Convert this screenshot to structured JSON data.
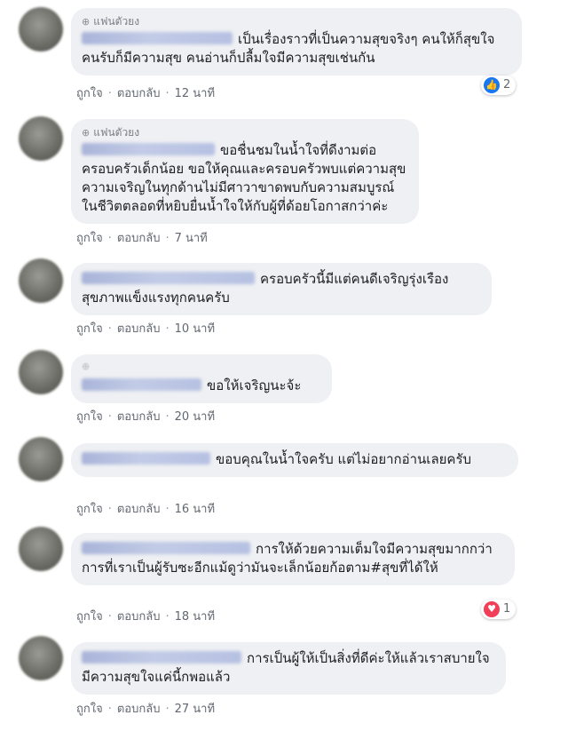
{
  "actions": {
    "like_label": "ถูกใจ",
    "reply_label": "ตอบกลับ",
    "separator": "·"
  },
  "comments": [
    {
      "badge": "แฟนตัวยง",
      "text": "เป็นเรื่องราวที่เป็นความสุขจริงๆ คนให้ก็สุขใจ คนรับก็มีความสุข คนอ่านก็ปลื้มใจมีความสุขเช่นกัน",
      "time": "12 นาที",
      "reaction": {
        "icon": "like-icon",
        "count": "2"
      }
    },
    {
      "badge": "แฟนตัวยง",
      "text": "ขอชื่นชมในน้ำใจที่ดีงามต่อครอบครัวเด็กน้อย ขอให้คุณและครอบครัวพบแต่ความสุขความเจริญในทุกด้านไม่มีศาวาขาดพบกับความสมบูรณ์ในชีวิตตลอดที่หยิบยื่นน้ำใจให้กับผู้ที่ด้อยโอกาสกว่าค่ะ",
      "time": "7 นาที"
    },
    {
      "text": "ครอบครัวนี้มีแต่คนดีเจริญรุ่งเรืองสุขภาพแข็งแรงทุกคนครับ",
      "time": "10 นาที"
    },
    {
      "text": "ขอให้เจริญนะจ้ะ",
      "time": "20 นาที"
    },
    {
      "text": "ขอบคุณในน้ำใจครับ แต่ไม่อยากอ่านเลยครับ",
      "time": "16 นาที"
    },
    {
      "text": "การให้ด้วยความเต็มใจมีความสุขมากกว่าการที่เราเป็นผู้รับซะอีกแม้ดูว่ามันจะเล็กน้อยก้อตาม#สุขที่ได้ให้",
      "time": "18 นาที",
      "reaction": {
        "icon": "love-icon",
        "count": "1"
      }
    },
    {
      "text": "การเป็นผู้ให้เป็นสิ่งที่ดีค่ะให้แล้วเราสบายใจมีความสุขใจแค่นี้กพอแล้ว",
      "time": "27 นาที"
    }
  ]
}
